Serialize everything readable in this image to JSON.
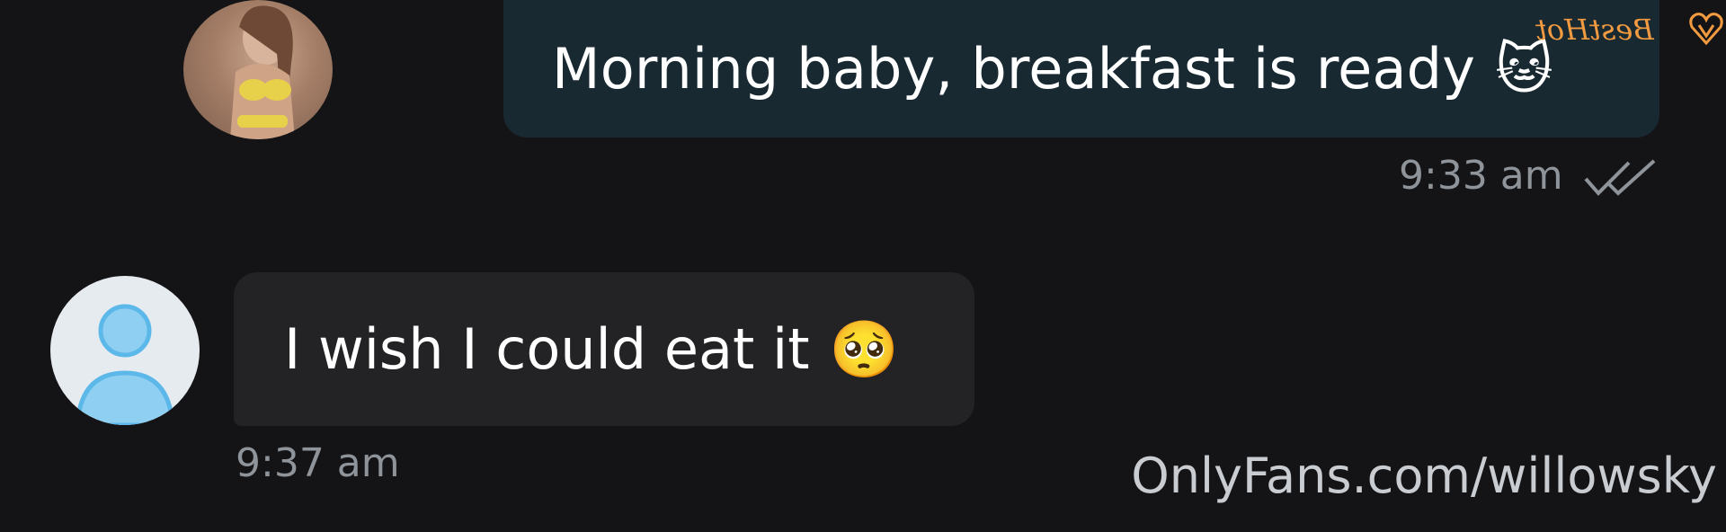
{
  "messages": [
    {
      "direction": "outgoing",
      "text": "Morning baby, breakfast is ready",
      "emoji": "🐱",
      "time": "9:33 am",
      "status_icon": "double-check-icon"
    },
    {
      "direction": "incoming",
      "text": "I wish I could eat it",
      "emoji": "🥺",
      "time": "9:37 am"
    }
  ],
  "watermark": "OnlyFans.com/willowsky",
  "brand_logo": "BestHot",
  "colors": {
    "background": "#141416",
    "outgoing_bubble": "#182932",
    "incoming_bubble": "#232326",
    "timestamp": "#8e949a",
    "brand": "#f29a3f",
    "user_avatar_accent": "#5db8ea"
  }
}
